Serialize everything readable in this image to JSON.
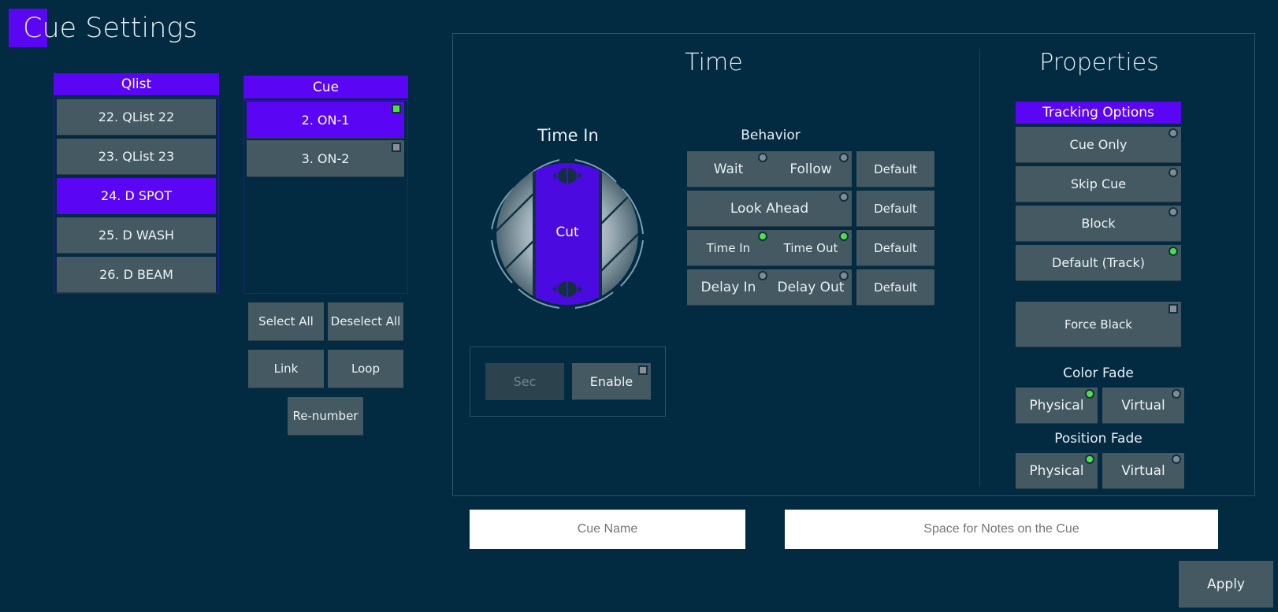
{
  "page": {
    "title": "Cue Settings"
  },
  "qlist": {
    "header": "Qlist",
    "items": [
      {
        "label": "22. QList 22",
        "selected": false
      },
      {
        "label": "23. QList 23",
        "selected": false
      },
      {
        "label": "24. D SPOT",
        "selected": true
      },
      {
        "label": "25. D WASH",
        "selected": false
      },
      {
        "label": "26. D BEAM",
        "selected": false
      }
    ]
  },
  "cue": {
    "header": "Cue",
    "items": [
      {
        "label": "2. ON-1",
        "selected": true,
        "checked": true
      },
      {
        "label": "3. ON-2",
        "selected": false,
        "checked": false
      }
    ],
    "buttons": {
      "select_all": "Select All",
      "deselect_all": "Deselect All",
      "link": "Link",
      "loop": "Loop",
      "renumber": "Re-number"
    }
  },
  "time": {
    "section_title": "Time",
    "dial": {
      "label": "Time In",
      "value": "Cut"
    },
    "unit_button": "Sec",
    "enable_button": "Enable",
    "enable_checked": false,
    "behavior": {
      "label": "Behavior",
      "rows": [
        {
          "left": {
            "label": "Wait",
            "on": false
          },
          "right": {
            "label": "Follow",
            "on": false
          },
          "default": "Default"
        },
        {
          "full": {
            "label": "Look Ahead",
            "on": false
          },
          "default": "Default"
        },
        {
          "left": {
            "label": "Time In",
            "on": true
          },
          "right": {
            "label": "Time Out",
            "on": true
          },
          "default": "Default"
        },
        {
          "left": {
            "label": "Delay In",
            "on": false
          },
          "right": {
            "label": "Delay Out",
            "on": false
          },
          "default": "Default"
        }
      ]
    }
  },
  "properties": {
    "section_title": "Properties",
    "tracking_header": "Tracking Options",
    "tracking": [
      {
        "label": "Cue Only",
        "on": false
      },
      {
        "label": "Skip Cue",
        "on": false
      },
      {
        "label": "Block",
        "on": false
      },
      {
        "label": "Default (Track)",
        "on": true
      }
    ],
    "force_black": {
      "label": "Force Black",
      "checked": false
    },
    "color_fade": {
      "label": "Color Fade",
      "physical": {
        "label": "Physical",
        "on": true
      },
      "virtual": {
        "label": "Virtual",
        "on": false
      }
    },
    "position_fade": {
      "label": "Position Fade",
      "physical": {
        "label": "Physical",
        "on": true
      },
      "virtual": {
        "label": "Virtual",
        "on": false
      }
    }
  },
  "inputs": {
    "cue_name": {
      "value": "",
      "placeholder": "Cue Name"
    },
    "notes": {
      "value": "",
      "placeholder": "Space for Notes on the Cue"
    }
  },
  "apply_button": "Apply",
  "colors": {
    "background": "#022a40",
    "accent": "#5a06f5",
    "button": "#445961",
    "led_on": "#4ee04a",
    "led_off": "#7f8c93"
  }
}
